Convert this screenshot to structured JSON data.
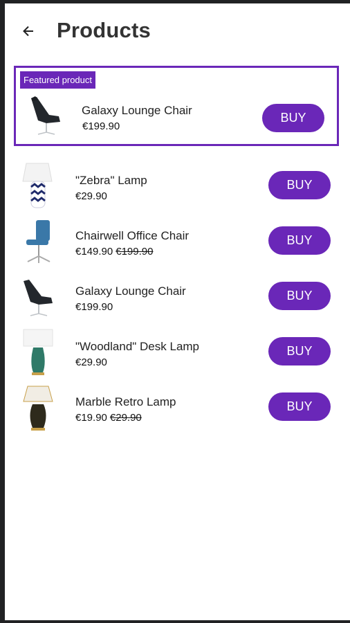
{
  "header": {
    "title": "Products",
    "back_icon": "arrow-left-icon"
  },
  "featured": {
    "badge": "Featured product",
    "product": {
      "name": "Galaxy Lounge Chair",
      "price": "€199.90",
      "old_price": null,
      "image": "lounge-chair",
      "buy_label": "BUY"
    }
  },
  "products": [
    {
      "name": "\"Zebra\" Lamp",
      "price": "€29.90",
      "old_price": null,
      "image": "zebra-lamp",
      "buy_label": "BUY"
    },
    {
      "name": "Chairwell Office Chair",
      "price": "€149.90",
      "old_price": "€199.90",
      "image": "office-chair",
      "buy_label": "BUY"
    },
    {
      "name": "Galaxy Lounge Chair",
      "price": "€199.90",
      "old_price": null,
      "image": "lounge-chair",
      "buy_label": "BUY"
    },
    {
      "name": "\"Woodland\" Desk Lamp",
      "price": "€29.90",
      "old_price": null,
      "image": "woodland-lamp",
      "buy_label": "BUY"
    },
    {
      "name": "Marble Retro Lamp",
      "price": "€19.90",
      "old_price": "€29.90",
      "image": "retro-lamp",
      "buy_label": "BUY"
    }
  ],
  "colors": {
    "accent": "#6a27b8",
    "text": "#222222",
    "frame": "#212224"
  }
}
